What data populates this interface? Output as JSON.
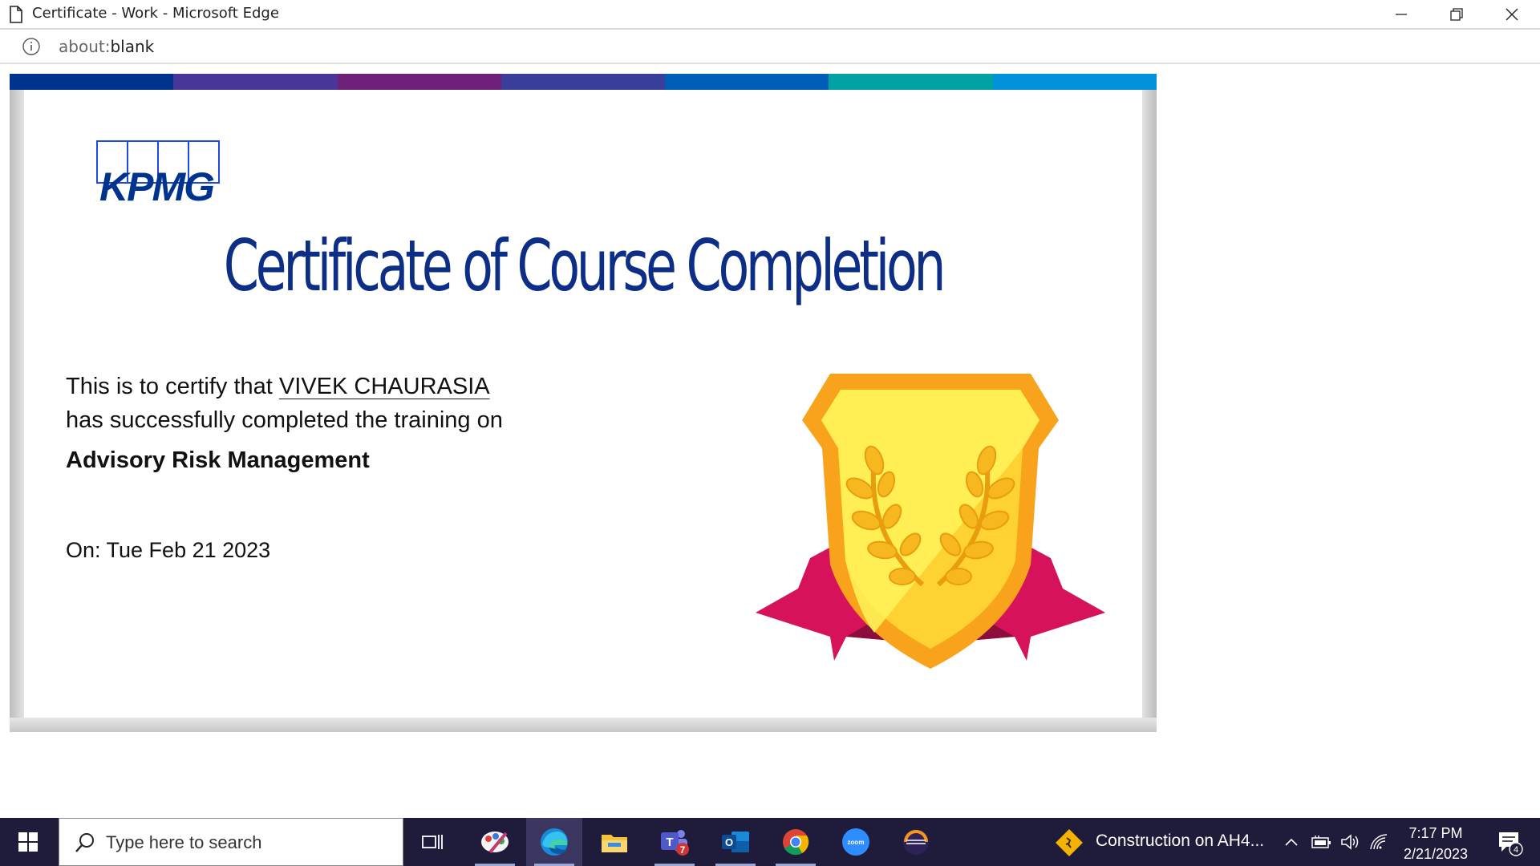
{
  "window": {
    "title": "Certificate - Work - Microsoft Edge",
    "url_protocol": "about:",
    "url_path": "blank"
  },
  "certificate": {
    "logo_text": "KPMG",
    "heading": "Certificate of Course Completion",
    "certify_prefix": "This is to certify that ",
    "recipient_name": "VIVEK CHAURASIA",
    "completed_text": "has successfully completed the training on",
    "course_name": "Advisory Risk Management",
    "date_text": "On: Tue Feb 21 2023",
    "stripe_colors": [
      "#00338d",
      "#483698",
      "#6d2077",
      "#3b3d9a",
      "#005eb8",
      "#00a3a1",
      "#0091da"
    ],
    "heading_color": "#0c2e86"
  },
  "taskbar": {
    "search_placeholder": "Type here to search",
    "teams_badge": "7",
    "zoom_label": "zoom",
    "weather_text": "Construction on AH4...",
    "time": "7:17 PM",
    "date": "2/21/2023",
    "notification_count": "4",
    "apps": [
      "task-view-icon",
      "paint-icon",
      "edge-icon",
      "file-explorer-icon",
      "teams-icon",
      "outlook-icon",
      "chrome-icon",
      "zoom-icon",
      "eclipse-icon"
    ]
  }
}
